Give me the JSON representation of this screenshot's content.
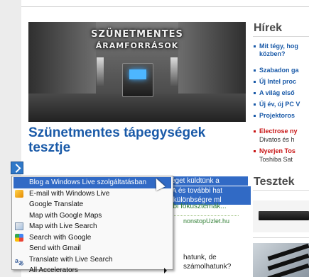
{
  "article": {
    "hero_line1": "SZÜNETMENTES",
    "hero_line2": "ÁRAMFORRÁSOK",
    "title": "Szünetmentes tápegységek tesztje",
    "selected_lines": [
      "séget küldtünk a",
      "VA és további hat",
      "s különbségre ml"
    ],
    "more_link": "bbi fókusztémák...",
    "source": "nonstopUzlet.hu",
    "teaser_lines": [
      "hatunk, de",
      "számolhatunk?"
    ]
  },
  "sidebar": {
    "news_heading": "Hírek",
    "news": [
      {
        "text": "Mit tégy, hog",
        "color": "blue"
      },
      {
        "text": "közben?",
        "color": "blue",
        "continuation": true
      },
      {
        "text": "Szabadon ga",
        "color": "blue"
      },
      {
        "text": "Új Intel proc",
        "color": "blue"
      },
      {
        "text": "A világ első",
        "color": "blue"
      },
      {
        "text": "Új év, új PC V",
        "color": "blue"
      },
      {
        "text": "Projektoros",
        "color": "blue"
      },
      {
        "text": "Electrose ny",
        "color": "red",
        "sub": "Divatos és h"
      },
      {
        "text": "Nyerjen Tos",
        "color": "red",
        "sub": "Toshiba Sat"
      }
    ],
    "tests_heading": "Tesztek"
  },
  "accelerator_menu": {
    "items": [
      {
        "label": "Blog a Windows Live szolgáltatásban",
        "icon": "none",
        "highlighted": true
      },
      {
        "label": "E-mail with Windows Live",
        "icon": "windows-live-mail-icon"
      },
      {
        "label": "Google Translate",
        "icon": "none"
      },
      {
        "label": "Map with Google Maps",
        "icon": "none"
      },
      {
        "label": "Map with Live Search",
        "icon": "live-map-icon"
      },
      {
        "label": "Search with Google",
        "icon": "google-icon"
      },
      {
        "label": "Send with Gmail",
        "icon": "none"
      },
      {
        "label": "Translate with Live Search",
        "icon": "translate-icon"
      },
      {
        "label": "All Accelerators",
        "icon": "none",
        "submenu": true
      }
    ]
  },
  "colors": {
    "link_blue": "#1a5aa8",
    "highlight": "#316ac5",
    "news_red": "#c81414"
  }
}
